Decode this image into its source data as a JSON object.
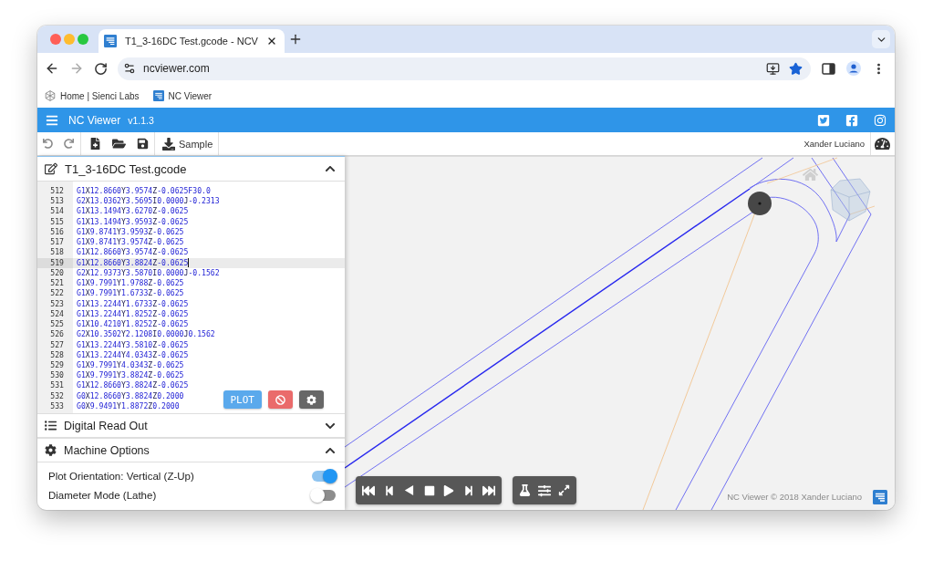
{
  "browser": {
    "tabs": [
      {
        "title": "T1_3-16DC Test.gcode - NCV",
        "selected": true
      }
    ],
    "address": "ncviewer.com",
    "bookmarks": [
      {
        "label": "Home | Sienci Labs",
        "kind": "site"
      },
      {
        "label": "NC Viewer",
        "kind": "app"
      }
    ]
  },
  "header": {
    "title": "NC Viewer",
    "version": "v1.1.3"
  },
  "toolbar": {
    "sample": "Sample",
    "user": "Xander Luciano"
  },
  "editor": {
    "file_name": "T1_3-16DC Test.gcode",
    "expanded": true,
    "plot": "PLOT",
    "lines": [
      {
        "number": "512",
        "code": "G1X12.8660Y3.9574Z-0.0625F30.0",
        "selected": false
      },
      {
        "number": "513",
        "code": "G2X13.0362Y3.5695I0.0000J-0.2313",
        "selected": false
      },
      {
        "number": "514",
        "code": "G1X13.1494Y3.6270Z-0.0625",
        "selected": false
      },
      {
        "number": "515",
        "code": "G1X13.1494Y3.9593Z-0.0625",
        "selected": false
      },
      {
        "number": "516",
        "code": "G1X9.8741Y3.9593Z-0.0625",
        "selected": false
      },
      {
        "number": "517",
        "code": "G1X9.8741Y3.9574Z-0.0625",
        "selected": false
      },
      {
        "number": "518",
        "code": "G1X12.8660Y3.9574Z-0.0625",
        "selected": false
      },
      {
        "number": "519",
        "code": "G1X12.8660Y3.8824Z-0.0625",
        "selected": true
      },
      {
        "number": "520",
        "code": "G2X12.9373Y3.5870I0.0000J-0.1562",
        "selected": false
      },
      {
        "number": "521",
        "code": "G1X9.7991Y1.9788Z-0.0625",
        "selected": false
      },
      {
        "number": "522",
        "code": "G1X9.7991Y1.6733Z-0.0625",
        "selected": false
      },
      {
        "number": "523",
        "code": "G1X13.2244Y1.6733Z-0.0625",
        "selected": false
      },
      {
        "number": "524",
        "code": "G1X13.2244Y1.8252Z-0.0625",
        "selected": false
      },
      {
        "number": "525",
        "code": "G1X10.4210Y1.8252Z-0.0625",
        "selected": false
      },
      {
        "number": "526",
        "code": "G2X10.3502Y2.1208I0.0000J0.1562",
        "selected": false
      },
      {
        "number": "527",
        "code": "G1X13.2244Y3.5810Z-0.0625",
        "selected": false
      },
      {
        "number": "528",
        "code": "G1X13.2244Y4.0343Z-0.0625",
        "selected": false
      },
      {
        "number": "529",
        "code": "G1X9.7991Y4.0343Z-0.0625",
        "selected": false
      },
      {
        "number": "530",
        "code": "G1X9.7991Y3.8824Z-0.0625",
        "selected": false
      },
      {
        "number": "531",
        "code": "G1X12.8660Y3.8824Z-0.0625",
        "selected": false
      },
      {
        "number": "532",
        "code": "G0X12.8660Y3.8824Z0.2000",
        "selected": false
      },
      {
        "number": "533",
        "code": "G0X9.9491Y1.8872Z0.2000",
        "selected": false
      }
    ]
  },
  "panels": [
    {
      "title": "Digital Read Out",
      "kind": "readout",
      "expanded": false
    },
    {
      "title": "Machine Options",
      "kind": "options",
      "expanded": true,
      "options": [
        {
          "label": "Plot Orientation: Vertical (Z-Up)",
          "on": true
        },
        {
          "label": "Diameter Mode (Lathe)",
          "on": false
        }
      ]
    }
  ],
  "viewer": {
    "footer": "NC Viewer © 2018 Xander Luciano"
  }
}
